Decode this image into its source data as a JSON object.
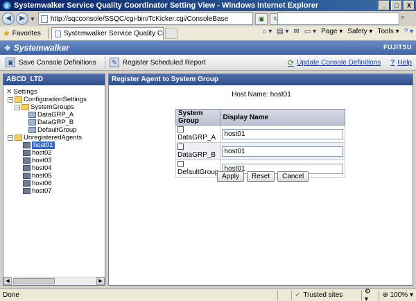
{
  "window": {
    "title": "Systemwalker Service Quality Coordinator Setting View - Windows Internet Explorer",
    "buttons": [
      "_",
      "□",
      "X"
    ]
  },
  "browser": {
    "address": "http://sqcconsole/SSQC/cgi-bin/TcKicker.cgi/ConsoleBase",
    "favorites_label": "Favorites",
    "tab_label": "Systemwalker Service Quality Coordinator ...",
    "commands": {
      "page": "Page",
      "safety": "Safety",
      "tools": "Tools"
    }
  },
  "app": {
    "brand": "Systemwalker",
    "vendor": "FUJITSU"
  },
  "toolbar": {
    "save_label": "Save Console Definitions",
    "register_label": "Register Scheduled Report",
    "update_label": "Update Console Definitions",
    "help_label": "Help"
  },
  "left_panel": {
    "title": "ABCD_LTD",
    "tree": {
      "settings": "Settings",
      "configuration": "ConfigurationSettings",
      "system_groups": "SystemGroups",
      "groups": [
        "DataGRP_A",
        "DataGRP_B",
        "DefaultGroup"
      ],
      "unregistered": "UnregisteredAgents",
      "hosts": [
        "host01",
        "host02",
        "host03",
        "host04",
        "host05",
        "host06",
        "host07"
      ]
    }
  },
  "right_panel": {
    "title": "Register Agent to System Group",
    "host_name_label": "Host Name:",
    "host_name_value": "host01",
    "columns": [
      "System Group",
      "Display Name"
    ],
    "rows": [
      {
        "group": "DataGRP_A",
        "display_name": "host01",
        "checked": false
      },
      {
        "group": "DataGRP_B",
        "display_name": "host01",
        "checked": false
      },
      {
        "group": "DefaultGroup",
        "display_name": "host01",
        "checked": false
      }
    ],
    "buttons": {
      "apply": "Apply",
      "reset": "Reset",
      "cancel": "Cancel"
    }
  },
  "statusbar": {
    "status": "Done",
    "zone": "Trusted sites",
    "zoom": "100%"
  }
}
